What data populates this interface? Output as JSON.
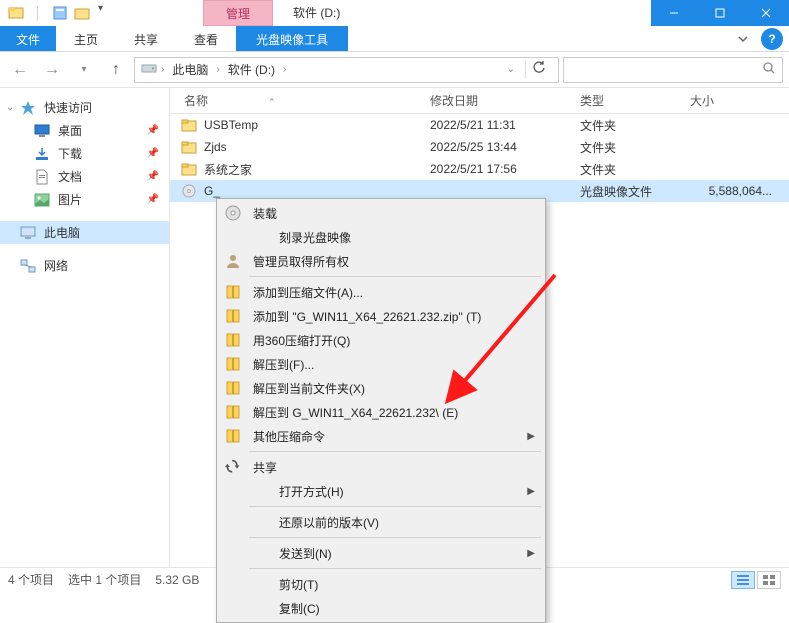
{
  "titlebar": {
    "tools_tab": "管理",
    "drive_tab": "软件 (D:)"
  },
  "menubar": {
    "file": "文件",
    "home": "主页",
    "share": "共享",
    "view": "查看",
    "disc_tools": "光盘映像工具"
  },
  "breadcrumb": {
    "pc": "此电脑",
    "drive": "软件 (D:)"
  },
  "columns": {
    "name": "名称",
    "modified": "修改日期",
    "type": "类型",
    "size": "大小"
  },
  "sidebar": {
    "quick_access": "快速访问",
    "desktop": "桌面",
    "downloads": "下载",
    "documents": "文档",
    "pictures": "图片",
    "this_pc": "此电脑",
    "network": "网络"
  },
  "files": [
    {
      "name": "USBTemp",
      "date": "2022/5/21 11:31",
      "type": "文件夹",
      "size": "",
      "kind": "folder"
    },
    {
      "name": "Zjds",
      "date": "2022/5/25 13:44",
      "type": "文件夹",
      "size": "",
      "kind": "folder"
    },
    {
      "name": "系统之家",
      "date": "2022/5/21 17:56",
      "type": "文件夹",
      "size": "",
      "kind": "folder"
    },
    {
      "name": "G_",
      "date": "",
      "type": "光盘映像文件",
      "size": "5,588,064...",
      "kind": "iso",
      "selected": true
    }
  ],
  "context_menu": {
    "mount": "装载",
    "burn": "刻录光盘映像",
    "admin": "管理员取得所有权",
    "add_archive": "添加到压缩文件(A)...",
    "add_to_zip": "添加到 \"G_WIN11_X64_22621.232.zip\" (T)",
    "open_360": "用360压缩打开(Q)",
    "extract_f": "解压到(F)...",
    "extract_here": "解压到当前文件夹(X)",
    "extract_named": "解压到 G_WIN11_X64_22621.232\\ (E)",
    "other_compress": "其他压缩命令",
    "share": "共享",
    "open_with": "打开方式(H)",
    "restore": "还原以前的版本(V)",
    "send_to": "发送到(N)",
    "cut": "剪切(T)",
    "copy": "复制(C)"
  },
  "statusbar": {
    "count": "4 个项目",
    "selection": "选中 1 个项目",
    "size": "5.32 GB"
  }
}
